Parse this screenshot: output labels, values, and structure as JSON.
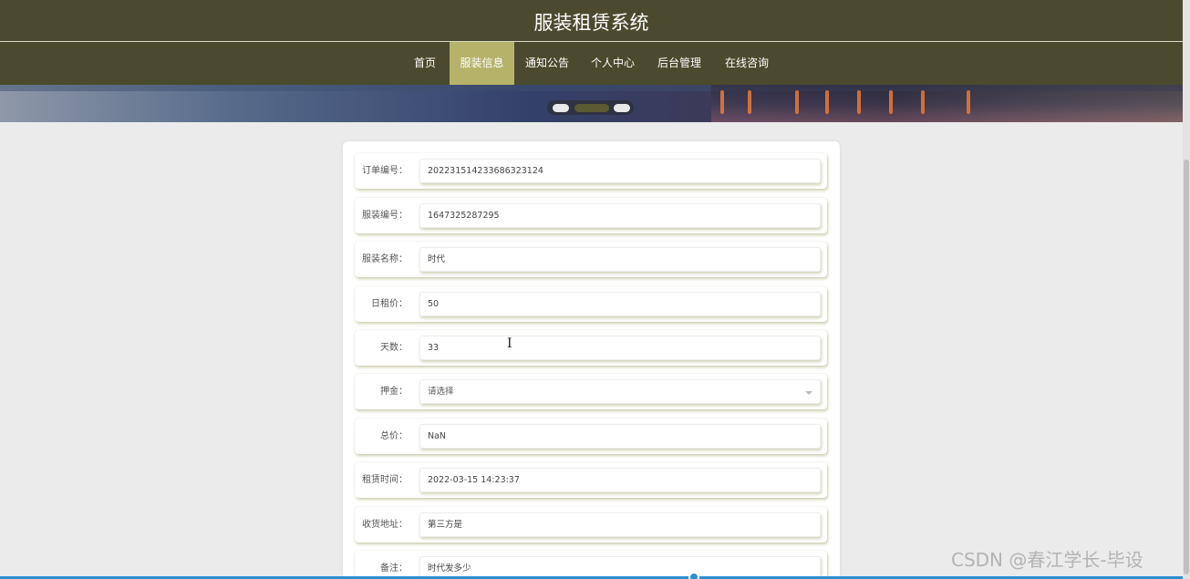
{
  "header": {
    "title": "服装租赁系统"
  },
  "nav": {
    "items": [
      {
        "label": "首页"
      },
      {
        "label": "服装信息"
      },
      {
        "label": "通知公告"
      },
      {
        "label": "个人中心"
      },
      {
        "label": "后台管理"
      },
      {
        "label": "在线咨询"
      }
    ],
    "active_index": 1
  },
  "form": {
    "rows": [
      {
        "label": "订单编号：",
        "value": "202231514233686323124"
      },
      {
        "label": "服装编号：",
        "value": "1647325287295"
      },
      {
        "label": "服装名称：",
        "value": "时代"
      },
      {
        "label": "日租价：",
        "value": "50"
      },
      {
        "label": "天数：",
        "value": "33"
      },
      {
        "label": "押金：",
        "value": "请选择",
        "type": "select"
      },
      {
        "label": "总价：",
        "value": "NaN"
      },
      {
        "label": "租赁时间：",
        "value": "2022-03-15 14:23:37"
      },
      {
        "label": "收货地址：",
        "value": "第三方是"
      },
      {
        "label": "备注：",
        "value": "时代发多少"
      }
    ]
  },
  "overlay": {
    "watermark": "CSDN @春江学长-毕设"
  },
  "colors": {
    "header_bg": "#4b4a2e",
    "nav_active": "#b6b26a",
    "page_bg": "#ebebeb",
    "accent_blue": "#2d8ecf"
  }
}
